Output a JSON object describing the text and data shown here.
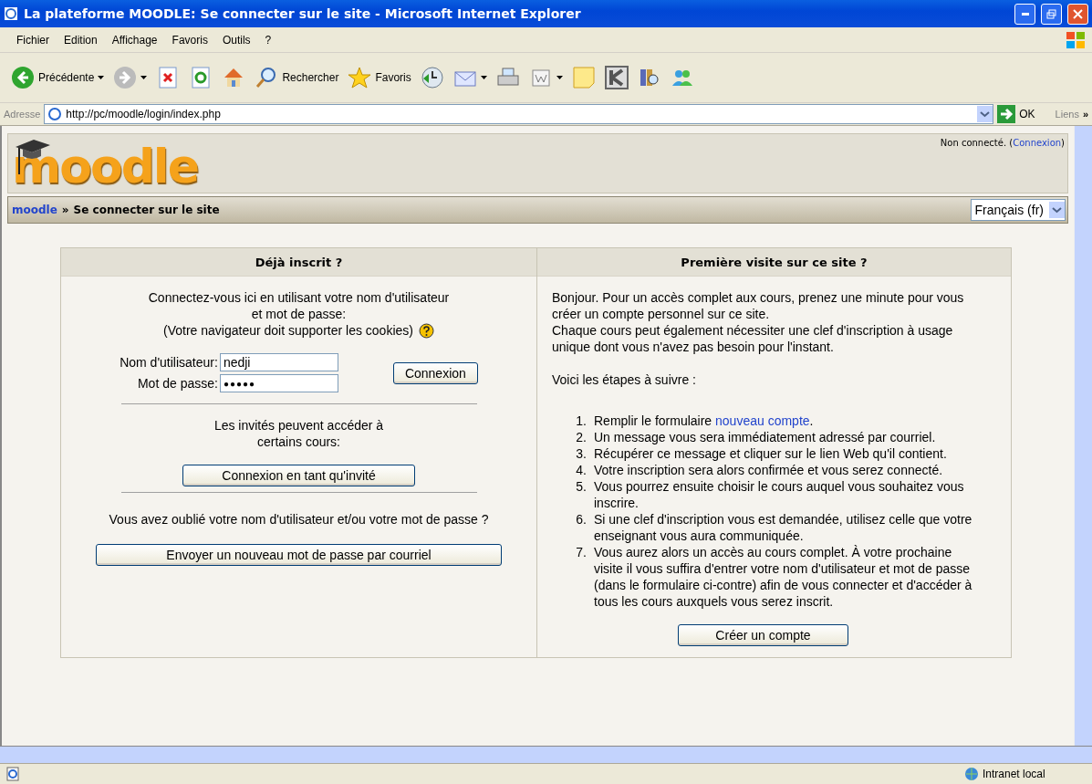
{
  "window": {
    "title": "La plateforme MOODLE: Se connecter sur le site - Microsoft Internet Explorer"
  },
  "menu": [
    "Fichier",
    "Edition",
    "Affichage",
    "Favoris",
    "Outils",
    "?"
  ],
  "toolbar": [
    {
      "kind": "back",
      "label": "Précédente"
    },
    {
      "kind": "forward"
    },
    {
      "kind": "stop"
    },
    {
      "kind": "refresh"
    },
    {
      "kind": "home"
    },
    {
      "kind": "search",
      "label": "Rechercher"
    },
    {
      "kind": "favorites",
      "label": "Favoris"
    },
    {
      "kind": "history"
    },
    {
      "kind": "mail"
    },
    {
      "kind": "print"
    },
    {
      "kind": "word"
    },
    {
      "kind": "note"
    },
    {
      "kind": "k"
    },
    {
      "kind": "books"
    },
    {
      "kind": "messenger"
    }
  ],
  "address": {
    "label": "Adresse",
    "url": "http://pc/moodle/login/index.php",
    "go": "OK",
    "links": "Liens",
    "more": "»"
  },
  "header": {
    "logo": "moodle",
    "status_prefix": "Non connecté. (",
    "status_link": "Connexion",
    "status_suffix": ")"
  },
  "breadcrumb": {
    "home": "moodle",
    "separator": "»",
    "current": "Se connecter sur le site",
    "language": "Français (fr)"
  },
  "login": {
    "heading": "Déjà inscrit ?",
    "intro": [
      "Connectez-vous ici en utilisant votre nom d'utilisateur",
      "et mot de passe:",
      "(Votre navigateur doit supporter les cookies)"
    ],
    "username_label": "Nom d'utilisateur:",
    "username": "nedji",
    "password_label": "Mot de passe:",
    "password": "●●●●●",
    "submit": "Connexion",
    "guest_text": "Les invités peuvent accéder à certains cours:",
    "guest_button": "Connexion en tant qu'invité",
    "forgot_text": "Vous avez oublié votre nom d'utilisateur et/ou votre mot de passe ?",
    "forgot_button": "Envoyer un nouveau mot de passe par courriel"
  },
  "signup": {
    "heading": "Première visite sur ce site ?",
    "paragraphs": [
      "Bonjour. Pour un accès complet aux cours, prenez une minute pour vous créer un compte personnel sur ce site.",
      "Chaque cours peut également nécessiter une clef d'inscription à usage unique dont vous n'avez pas besoin pour l'instant."
    ],
    "steps_intro": "Voici les étapes à suivre :",
    "steps": [
      {
        "number": "1.",
        "text": "Remplir le formulaire ",
        "link": "nouveau compte",
        "after": "."
      },
      {
        "number": "2.",
        "text": "Un message vous sera immédiatement adressé par courriel."
      },
      {
        "number": "3.",
        "text": "Récupérer ce message et cliquer sur le lien Web qu'il contient."
      },
      {
        "number": "4.",
        "text": "Votre inscription sera alors confirmée et vous serez connecté."
      },
      {
        "number": "5.",
        "text": "Vous pourrez ensuite choisir le cours auquel vous souhaitez vous inscrire."
      },
      {
        "number": "6.",
        "text": "Si une clef d'inscription vous est demandée, utilisez celle que votre enseignant vous aura communiquée."
      },
      {
        "number": "7.",
        "text": "Vous aurez alors un accès au cours complet. À votre prochaine visite il vous suffira d'entrer votre nom d'utilisateur et mot de passe (dans le formulaire ci-contre) afin de vous connecter et d'accéder à tous les cours auxquels vous serez inscrit."
      }
    ],
    "button": "Créer un compte"
  },
  "status_bar": {
    "zone": "Intranet local"
  }
}
